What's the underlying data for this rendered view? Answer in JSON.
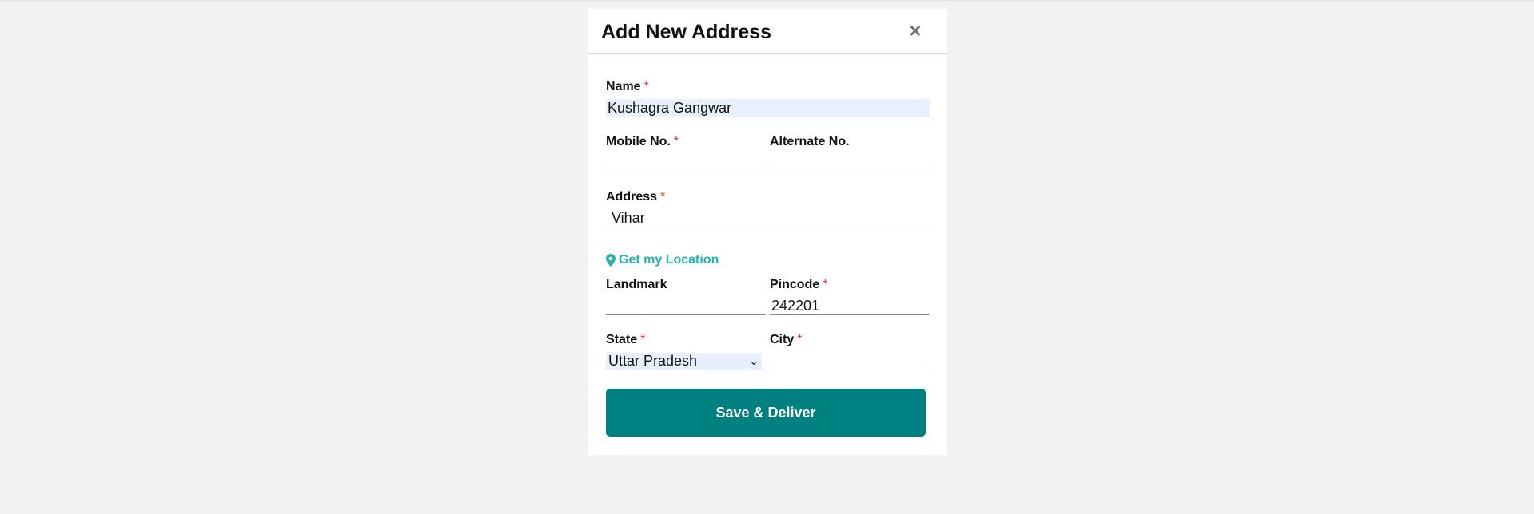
{
  "modal": {
    "title": "Add New Address",
    "close_label": "×"
  },
  "fields": {
    "name": {
      "label": "Name",
      "required": "*",
      "value": "Kushagra Gangwar"
    },
    "mobile": {
      "label": "Mobile No.",
      "required": "*",
      "value": ""
    },
    "alternate": {
      "label": "Alternate No.",
      "value": ""
    },
    "address": {
      "label": "Address",
      "required": "*",
      "value": " Vihar"
    },
    "landmark": {
      "label": "Landmark",
      "value": ""
    },
    "pincode": {
      "label": "Pincode",
      "required": "*",
      "value": "242201"
    },
    "state": {
      "label": "State",
      "required": "*",
      "value": "Uttar Pradesh"
    },
    "city": {
      "label": "City",
      "required": "*",
      "value": ""
    }
  },
  "location": {
    "label": "Get my Location",
    "icon": "map-marker-icon"
  },
  "actions": {
    "save_label": "Save & Deliver"
  },
  "colors": {
    "accent": "#008080",
    "link": "#22b3b1",
    "required": "#e0302b",
    "autofill": "#e8f0fe"
  }
}
